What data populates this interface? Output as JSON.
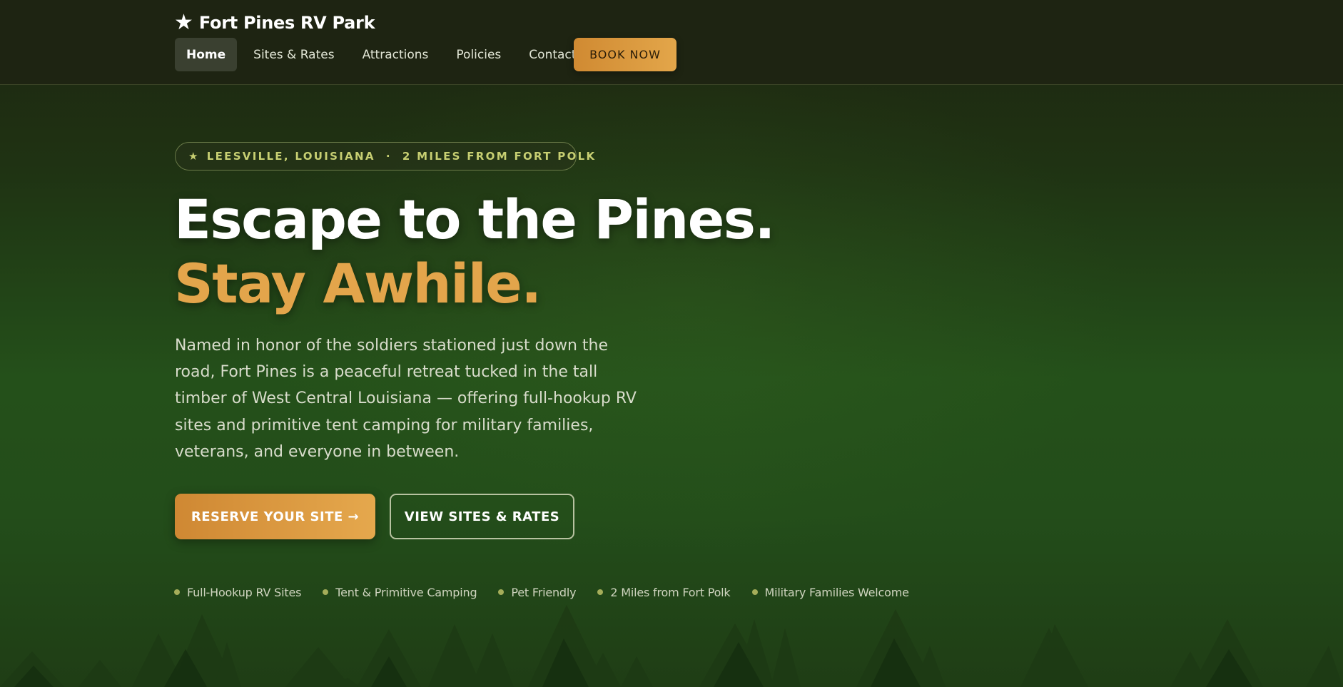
{
  "nav": {
    "brand": "Fort Pines RV Park",
    "links": [
      {
        "label": "Home",
        "active": true
      },
      {
        "label": "Sites & Rates",
        "active": false
      },
      {
        "label": "Attractions",
        "active": false
      },
      {
        "label": "Policies",
        "active": false
      },
      {
        "label": "Contact",
        "active": false
      }
    ],
    "cta": "BOOK NOW"
  },
  "hero": {
    "badge": "LEESVILLE, LOUISIANA  ·  2 MILES FROM FORT POLK",
    "headline_line1": "Escape to the Pines.",
    "headline_line2": "Stay Awhile.",
    "description": "Named in honor of the soldiers stationed just down the road, Fort Pines is a peaceful retreat tucked in the tall timber of West Central Louisiana — offering full-hookup RV sites and primitive tent camping for military families, veterans, and everyone in between.",
    "primary_button": "RESERVE YOUR SITE →",
    "secondary_button": "VIEW SITES & RATES",
    "features": [
      "Full-Hookup RV Sites",
      "Tent & Primitive Camping",
      "Pet Friendly",
      "2 Miles from Fort Polk",
      "Military Families Welcome"
    ]
  },
  "icons": {
    "brand": "star-icon",
    "badge": "star-icon",
    "feature_bullet": "dot-icon",
    "background": "pine-trees-silhouette"
  },
  "colors": {
    "accent": "#e3a54b",
    "badge_text": "#c7cf72",
    "nav_bg": "#1e2412",
    "forest_green": "#24501a"
  }
}
